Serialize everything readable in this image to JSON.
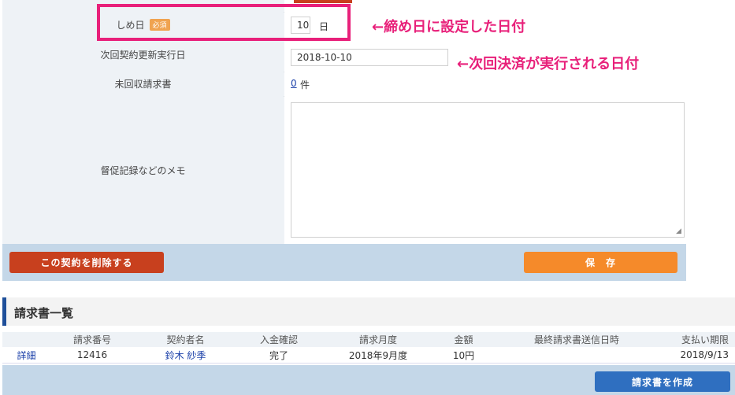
{
  "form": {
    "rows": [
      {
        "label": "しめ日",
        "badge": "必須",
        "value": "10",
        "unit": "日"
      },
      {
        "label": "次回契約更新実行日",
        "value": "2018-10-10"
      },
      {
        "label": "未回収請求書",
        "count": "0",
        "unit": "件"
      },
      {
        "label": "督促記録などのメモ",
        "value": ""
      }
    ]
  },
  "annotations": {
    "closing_day": "←締め日に設定した日付",
    "next_payment": "←次回決済が実行される日付"
  },
  "buttons": {
    "delete": "この契約を削除する",
    "save": "保　存",
    "create_invoice": "請求書を作成"
  },
  "invoices": {
    "title": "請求書一覧",
    "columns": [
      "",
      "請求番号",
      "契約者名",
      "入金確認",
      "請求月度",
      "金額",
      "最終請求書送信日時",
      "支払い期限"
    ],
    "rows": [
      {
        "detail": "詳細",
        "number": "12416",
        "name": "鈴木 紗季",
        "paid": "完了",
        "month": "2018年9月度",
        "amount": "10円",
        "sent": "",
        "due": "2018/9/13"
      }
    ]
  },
  "colors": {
    "accent_pink": "#e8207a",
    "save_orange": "#f58a2a",
    "delete_red": "#c8401e",
    "create_blue": "#2f6fc0",
    "link_blue": "#1a3fa8"
  }
}
